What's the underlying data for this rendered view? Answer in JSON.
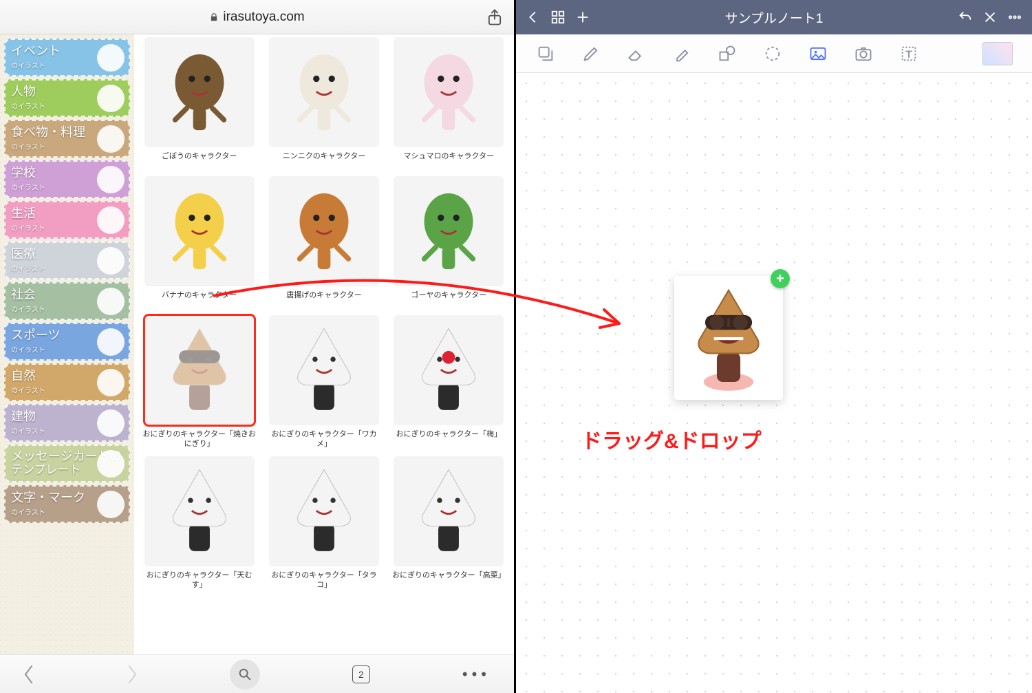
{
  "safari": {
    "url": "irasutoya.com",
    "tab_count": "2"
  },
  "sidebar_sub_label": "のイラスト",
  "categories": [
    {
      "label": "イベント",
      "color": "#86c3e6"
    },
    {
      "label": "人物",
      "color": "#9fcd5d"
    },
    {
      "label": "食べ物・料理",
      "color": "#c9a87d"
    },
    {
      "label": "学校",
      "color": "#cfa0d6"
    },
    {
      "label": "生活",
      "color": "#f29ec2"
    },
    {
      "label": "医療",
      "color": "#cfd3da"
    },
    {
      "label": "社会",
      "color": "#a4bfa2"
    },
    {
      "label": "スポーツ",
      "color": "#7aa6e0"
    },
    {
      "label": "自然",
      "color": "#d2a86a"
    },
    {
      "label": "建物",
      "color": "#bdb3cf"
    },
    {
      "label": "メッセージカードの",
      "title2": "テンプレート",
      "color": "#c9d3a0"
    },
    {
      "label": "文字・マーク",
      "color": "#b6a08a"
    }
  ],
  "gallery": [
    {
      "caption": "ごぼうのキャラクター"
    },
    {
      "caption": "ニンニクのキャラクター"
    },
    {
      "caption": "マシュマロのキャラクター"
    },
    {
      "caption": "バナナのキャラクター"
    },
    {
      "caption": "唐揚げのキャラクター"
    },
    {
      "caption": "ゴーヤのキャラクター"
    },
    {
      "caption": "おにぎりのキャラクター「焼きおにぎり」",
      "selected": true
    },
    {
      "caption": "おにぎりのキャラクター「ワカメ」"
    },
    {
      "caption": "おにぎりのキャラクター「梅」"
    },
    {
      "caption": "おにぎりのキャラクター「天むす」"
    },
    {
      "caption": "おにぎりのキャラクター「タラコ」"
    },
    {
      "caption": "おにぎりのキャラクター「高菜」"
    }
  ],
  "note": {
    "title": "サンプルノート1",
    "annotation": "ドラッグ&ドロップ",
    "plus_badge": "+"
  },
  "palette": {
    "accent_blue": "#4f74ff",
    "note_header": "#5d6681",
    "annotation_red": "#ff1a1a",
    "plus_green": "#3fd15c",
    "selection_red": "#ff2a1a"
  }
}
